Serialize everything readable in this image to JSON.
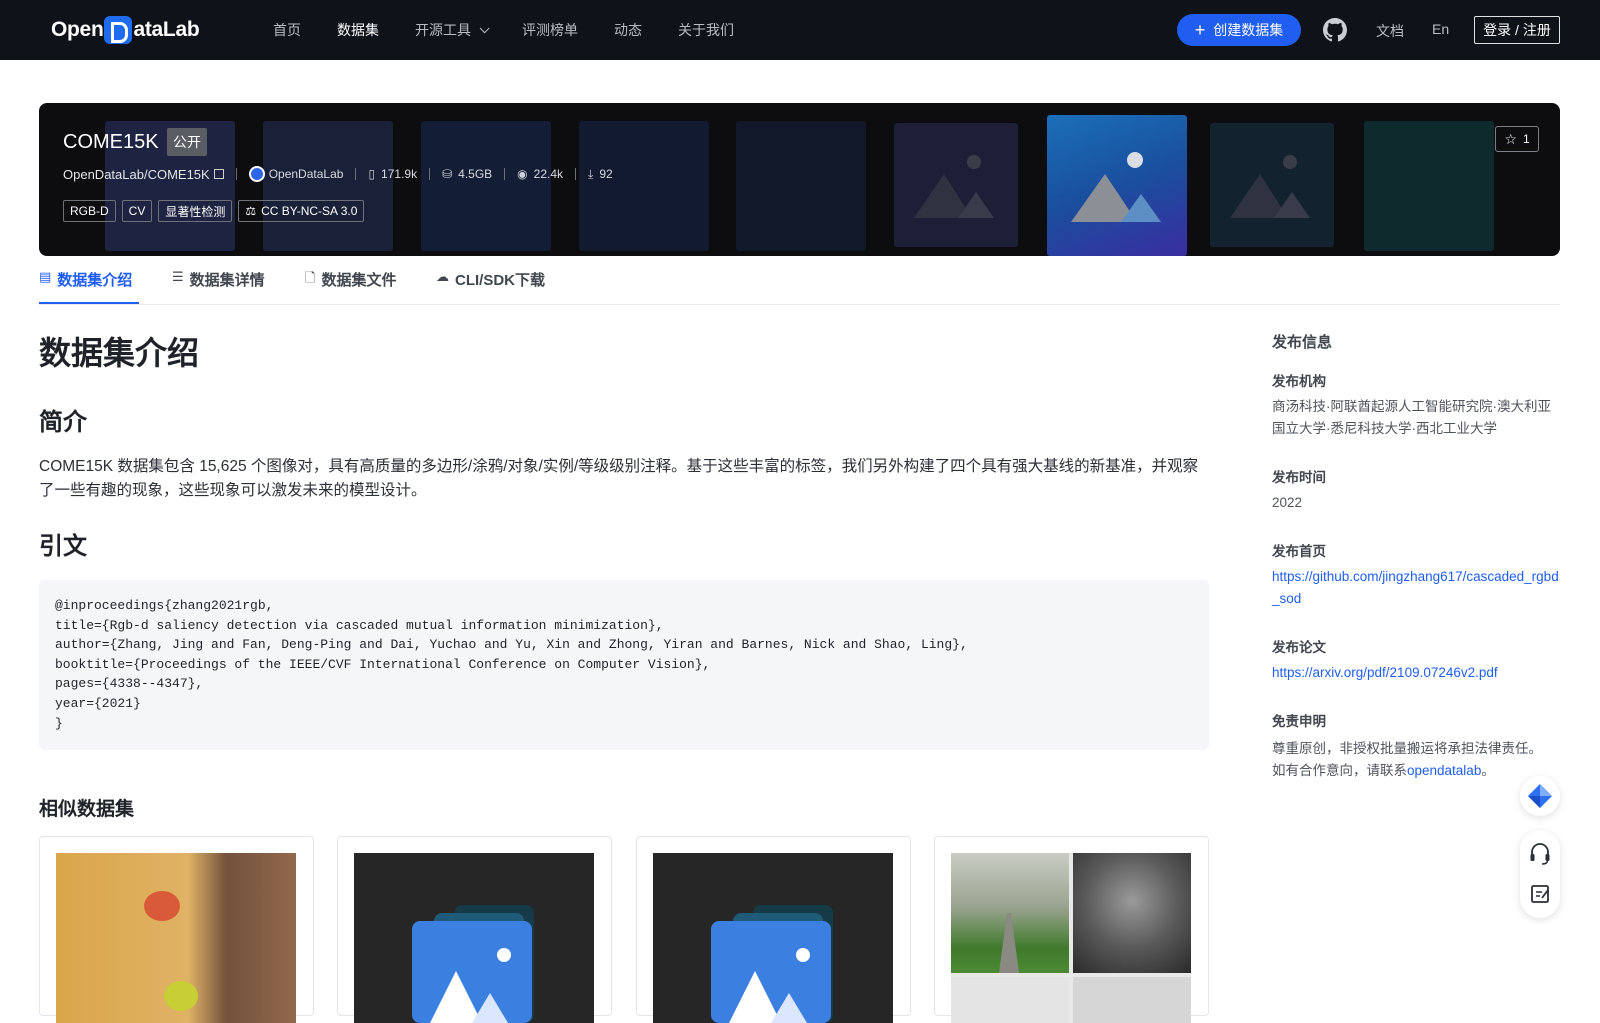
{
  "nav": {
    "logo_text_left": "Open",
    "logo_text_right": "ataLab",
    "links": [
      {
        "label": "首页"
      },
      {
        "label": "数据集",
        "active": true
      },
      {
        "label": "开源工具",
        "dropdown": true
      },
      {
        "label": "评测榜单"
      },
      {
        "label": "动态"
      },
      {
        "label": "关于我们"
      }
    ],
    "create_button": "创建数据集",
    "docs": "文档",
    "lang": "En",
    "login": "登录 / 注册"
  },
  "banner": {
    "title": "COME15K",
    "visibility": "公开",
    "path": "OpenDataLab/COME15K",
    "org": "OpenDataLab",
    "files": "171.9k",
    "size": "4.5GB",
    "views": "22.4k",
    "downloads": "92",
    "tags": [
      "RGB-D",
      "CV",
      "显著性检测"
    ],
    "license": "CC BY-NC-SA 3.0",
    "stars": "1"
  },
  "tabs": [
    {
      "label": "数据集介绍",
      "icon": "database-icon",
      "active": true
    },
    {
      "label": "数据集详情",
      "icon": "list-icon"
    },
    {
      "label": "数据集文件",
      "icon": "file-icon"
    },
    {
      "label": "CLI/SDK下载",
      "icon": "cloud-download-icon"
    }
  ],
  "main": {
    "heading": "数据集介绍",
    "intro_heading": "简介",
    "intro_text": "COME15K 数据集包含 15,625 个图像对，具有高质量的多边形/涂鸦/对象/实例/等级级别注释。基于这些丰富的标签，我们另外构建了四个具有强大基线的新基准，并观察了一些有趣的现象，这些现象可以激发未来的模型设计。",
    "citation_heading": "引文",
    "citation": "@inproceedings{zhang2021rgb,\ntitle={Rgb-d saliency detection via cascaded mutual information minimization},\nauthor={Zhang, Jing and Fan, Deng-Ping and Dai, Yuchao and Yu, Xin and Zhong, Yiran and Barnes, Nick and Shao, Ling},\nbooktitle={Proceedings of the IEEE/CVF International Conference on Computer Vision},\npages={4338--4347},\nyear={2021}\n}",
    "similar_heading": "相似数据集"
  },
  "sidebar": {
    "title": "发布信息",
    "org_label": "发布机构",
    "org_value": "商汤科技·阿联酋起源人工智能研究院·澳大利亚国立大学·悉尼科技大学·西北工业大学",
    "time_label": "发布时间",
    "time_value": "2022",
    "home_label": "发布首页",
    "home_value": "https://github.com/jingzhang617/cascaded_rgbd_sod",
    "paper_label": "发布论文",
    "paper_value": "https://arxiv.org/pdf/2109.07246v2.pdf",
    "disclaimer_label": "免责申明",
    "disclaimer_line1": "尊重原创，非授权批量搬运将承担法律责任。",
    "disclaimer_line2_pre": "如有合作意向，请联系",
    "disclaimer_link": "opendatalab",
    "disclaimer_line2_post": "。"
  },
  "colors": {
    "accent": "#1f5ef0",
    "nav_bg": "#0f1219"
  }
}
